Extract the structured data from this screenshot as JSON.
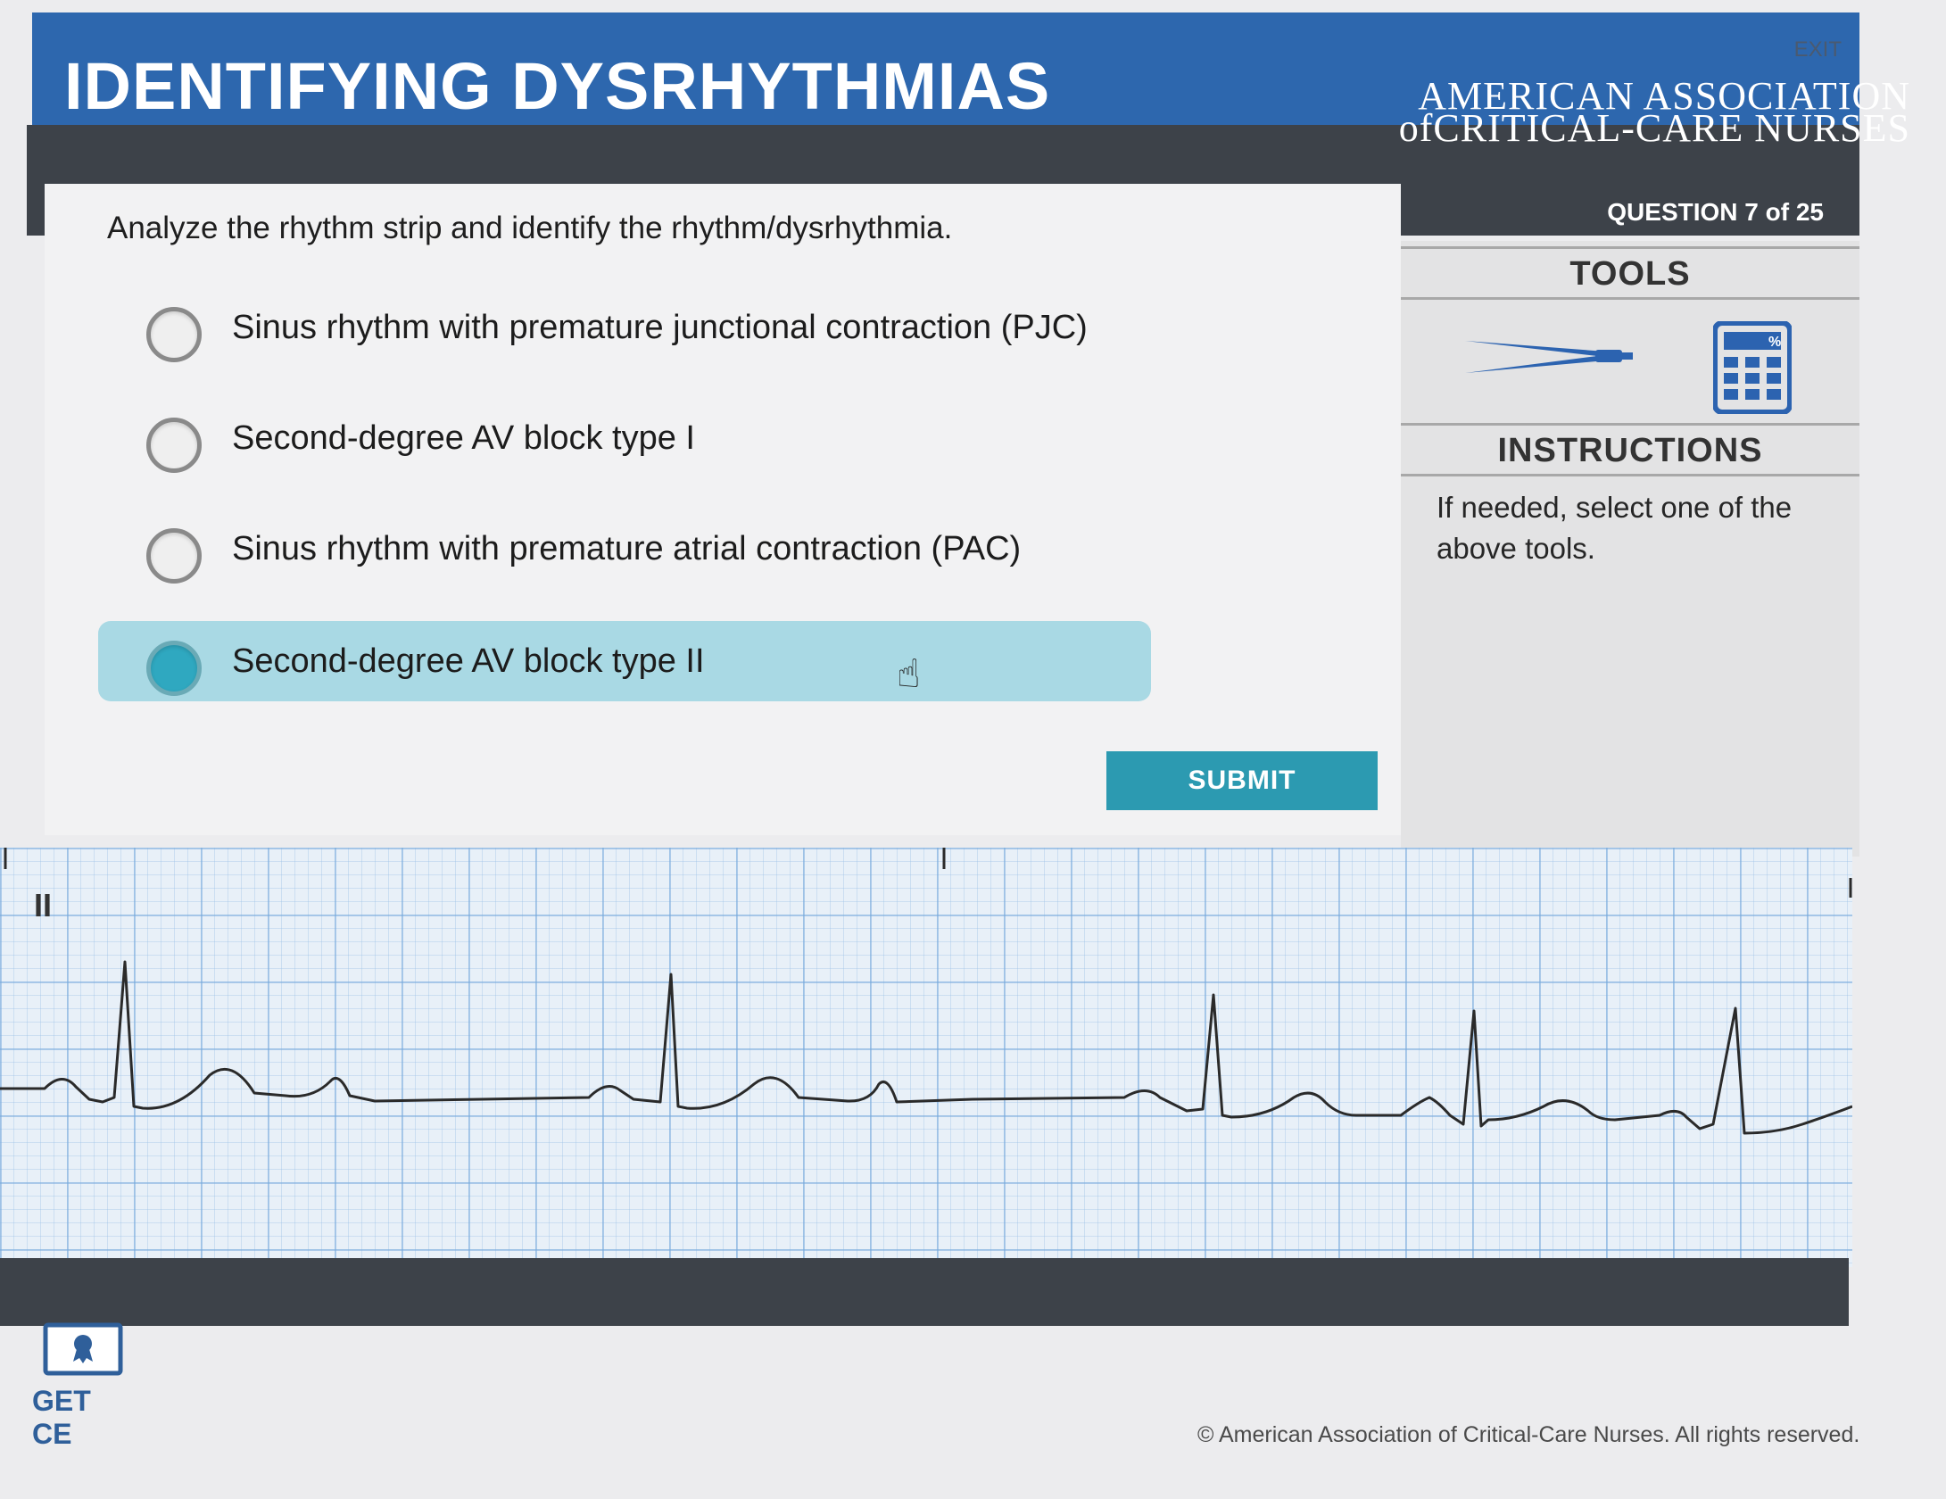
{
  "header": {
    "title": "IDENTIFYING DYSRHYTHMIAS",
    "exit_label": "EXIT",
    "org_line1": "AMERICAN ASSOCIATION",
    "org_line2": "ofCRITICAL-CARE NURSES",
    "question_counter": "QUESTION 7 of 25"
  },
  "question": {
    "prompt": "Analyze the rhythm strip and identify the rhythm/dysrhythmia.",
    "options": [
      {
        "label": "Sinus rhythm with premature junctional contraction (PJC)",
        "selected": false
      },
      {
        "label": "Second-degree AV block type I",
        "selected": false
      },
      {
        "label": "Sinus rhythm with premature atrial contraction (PAC)",
        "selected": false
      },
      {
        "label": "Second-degree AV block type II",
        "selected": true
      }
    ],
    "submit_label": "SUBMIT"
  },
  "tools": {
    "heading": "TOOLS",
    "items": [
      {
        "icon": "calipers-icon"
      },
      {
        "icon": "calculator-icon",
        "badge": "%"
      }
    ]
  },
  "instructions": {
    "heading": "INSTRUCTIONS",
    "text": "If needed, select one of the above tools."
  },
  "ecg": {
    "lead": "II"
  },
  "footer": {
    "get_ce_label": "GET CE",
    "copyright": "© American Association of Critical-Care Nurses. All rights reserved."
  },
  "colors": {
    "header_blue": "#2d67ae",
    "dark_band": "#3d4249",
    "accent_teal": "#2c9ab1",
    "selected_option": "#a9d9e4"
  }
}
